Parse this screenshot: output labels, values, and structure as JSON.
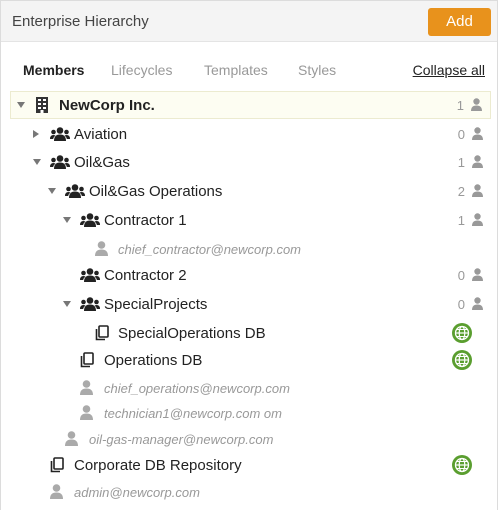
{
  "header": {
    "title": "Enterprise Hierarchy",
    "add_label": "Add"
  },
  "tabs": {
    "members": "Members",
    "lifecycles": "Lifecycles",
    "templates": "Templates",
    "styles": "Styles",
    "collapse_all": "Collapse all"
  },
  "tree": {
    "newcorp": {
      "label": "NewCorp Inc.",
      "count": "1"
    },
    "aviation": {
      "label": "Aviation",
      "count": "0"
    },
    "oilgas": {
      "label": "Oil&Gas",
      "count": "1"
    },
    "oilgas_ops": {
      "label": "Oil&Gas Operations",
      "count": "2"
    },
    "contractor1": {
      "label": "Contractor 1",
      "count": "1"
    },
    "chief_contractor": {
      "label": "chief_contractor@newcorp.com"
    },
    "contractor2": {
      "label": "Contractor 2",
      "count": "0"
    },
    "specialprojects": {
      "label": "SpecialProjects",
      "count": "0"
    },
    "specialops_db": {
      "label": "SpecialOperations DB"
    },
    "operations_db": {
      "label": "Operations DB"
    },
    "chief_operations": {
      "label": "chief_operations@newcorp.com"
    },
    "technician1": {
      "label": "technician1@newcorp.com om"
    },
    "oilgas_manager": {
      "label": "oil-gas-manager@newcorp.com"
    },
    "corporate_db": {
      "label": "Corporate DB Repository"
    },
    "admin": {
      "label": "admin@newcorp.com"
    }
  },
  "icons": {
    "building": "building-icon",
    "group": "user-group-icon",
    "user": "user-icon",
    "database": "database-copy-icon",
    "globe": "globe-icon"
  },
  "colors": {
    "accent": "#e8921c",
    "globe": "#5a9e2f",
    "muted": "#999999"
  }
}
